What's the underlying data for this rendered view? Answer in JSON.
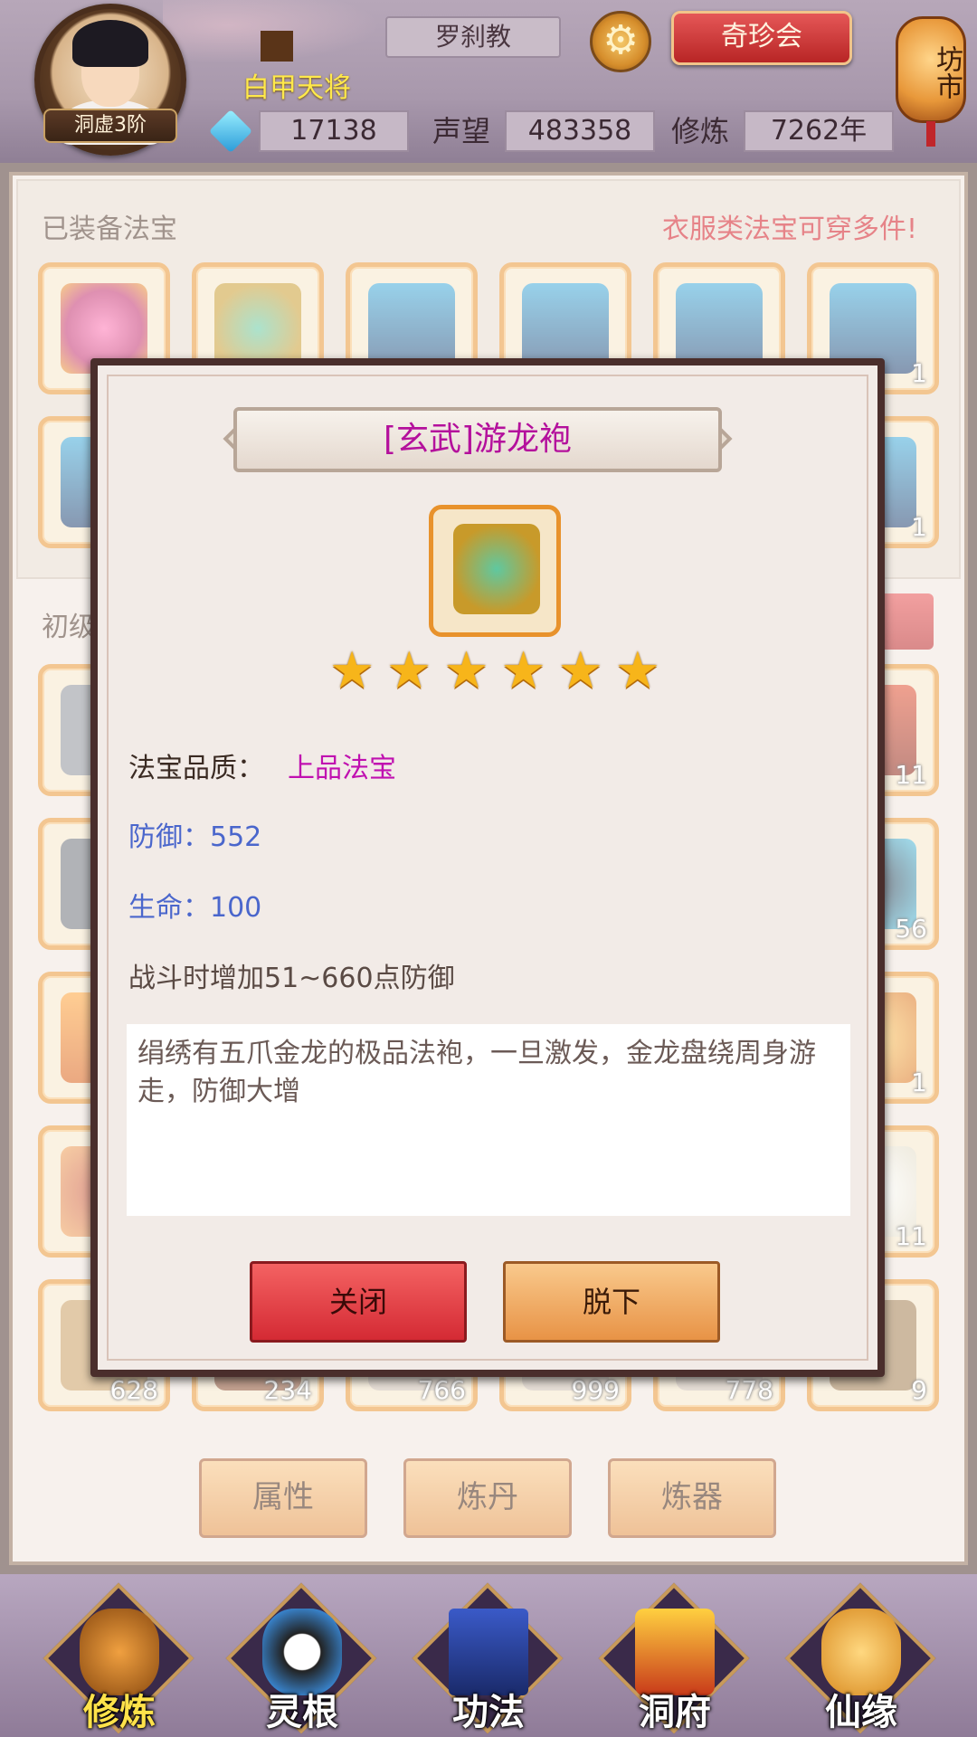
{
  "header": {
    "rank": "洞虚3阶",
    "player_name": "白甲天将",
    "sect": "罗刹教",
    "treasure_button": "奇珍会",
    "market_label": "坊市",
    "spirit_stones": "17138",
    "reputation_label": "声望",
    "reputation": "483358",
    "cultivation_label": "修炼",
    "cultivation": "7262年",
    "icons": {
      "settings": "gear-icon",
      "currency": "spirit-stone-icon"
    }
  },
  "equipped": {
    "title": "已装备法宝",
    "notice": "衣服类法宝可穿多件!",
    "slot_count_label": "1"
  },
  "bag": {
    "title": "初级储物戒",
    "counts": [
      "11",
      "56",
      "1",
      "11",
      "628",
      "234",
      "766",
      "999",
      "778",
      "9"
    ]
  },
  "bottom_buttons": [
    "属性",
    "炼丹",
    "炼器"
  ],
  "popup": {
    "title": "[玄武]游龙袍",
    "stars": 6,
    "quality_label": "法宝品质：",
    "quality_value": "上品法宝",
    "defense": "防御：552",
    "hp": "生命：100",
    "effect": "战斗时增加51~660点防御",
    "description": "绢绣有五爪金龙的极品法袍，一旦激发，金龙盘绕周身游走，防御大增",
    "close_label": "关闭",
    "unequip_label": "脱下"
  },
  "nav": {
    "items": [
      {
        "label": "修炼",
        "icon": "meditating-monk-icon",
        "active": true
      },
      {
        "label": "灵根",
        "icon": "yin-yang-sword-icon",
        "active": false
      },
      {
        "label": "功法",
        "icon": "scripture-book-icon",
        "active": false
      },
      {
        "label": "洞府",
        "icon": "pavilion-icon",
        "active": false
      },
      {
        "label": "仙缘",
        "icon": "gourd-icon",
        "active": false
      }
    ]
  },
  "colors": {
    "accent_orange": "#e8922c",
    "title_magenta": "#b4109c",
    "stat_blue": "#4a66cc",
    "notice_red": "#d0121b"
  }
}
